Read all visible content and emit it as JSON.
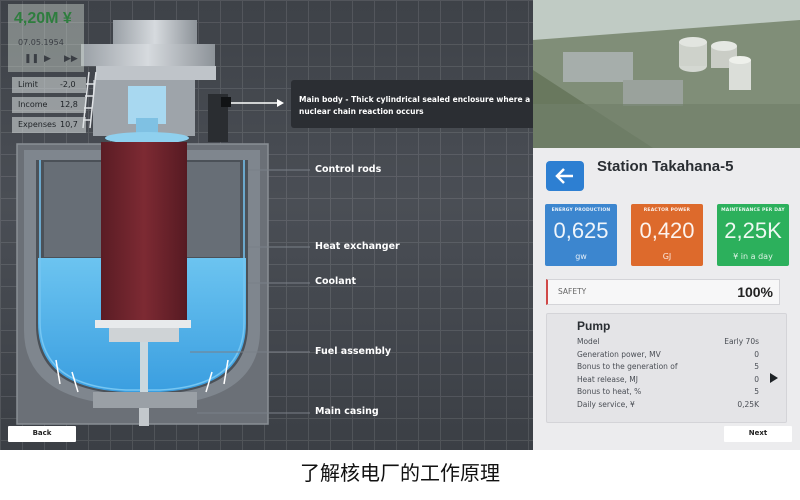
{
  "stats": {
    "money": "4,20M ¥",
    "date": "07.05.1954",
    "rows": [
      {
        "label": "Limit",
        "value": "-2,0"
      },
      {
        "label": "Income",
        "value": "12,8"
      },
      {
        "label": "Expenses",
        "value": "10,7"
      }
    ]
  },
  "callout": {
    "text": "Main body - Thick cylindrical sealed enclosure where a nuclear chain reaction occurs"
  },
  "parts": {
    "control_rods": "Control rods",
    "heat_exchanger": "Heat exchanger",
    "coolant": "Coolant",
    "fuel_assembly": "Fuel assembly",
    "main_casing": "Main casing"
  },
  "nav": {
    "back": "Back",
    "next": "Next"
  },
  "station": {
    "name": "Station Takahana-5"
  },
  "cards": [
    {
      "title": "ENERGY PRODUCTION",
      "value": "0,625",
      "unit": "gw",
      "color": "#3c86cf"
    },
    {
      "title": "REACTOR POWER",
      "value": "0,420",
      "unit": "GJ",
      "color": "#dd6a2c"
    },
    {
      "title": "MAINTENANCE PER DAY",
      "value": "2,25K",
      "unit": "¥ in a day",
      "color": "#2cb05c"
    }
  ],
  "safety": {
    "label": "SAFETY",
    "value": "100%"
  },
  "pump": {
    "title": "Pump",
    "rows": [
      {
        "key": "Model",
        "value": "Early 70s"
      },
      {
        "key": "Generation power, MV",
        "value": "0"
      },
      {
        "key": "Bonus to the generation of",
        "value": "5"
      },
      {
        "key": "Heat release, MJ",
        "value": "0"
      },
      {
        "key": "Bonus to heat, %",
        "value": "5"
      },
      {
        "key": "Daily service, ¥",
        "value": "0,25K"
      }
    ]
  },
  "caption": "了解核电厂的工作原理"
}
